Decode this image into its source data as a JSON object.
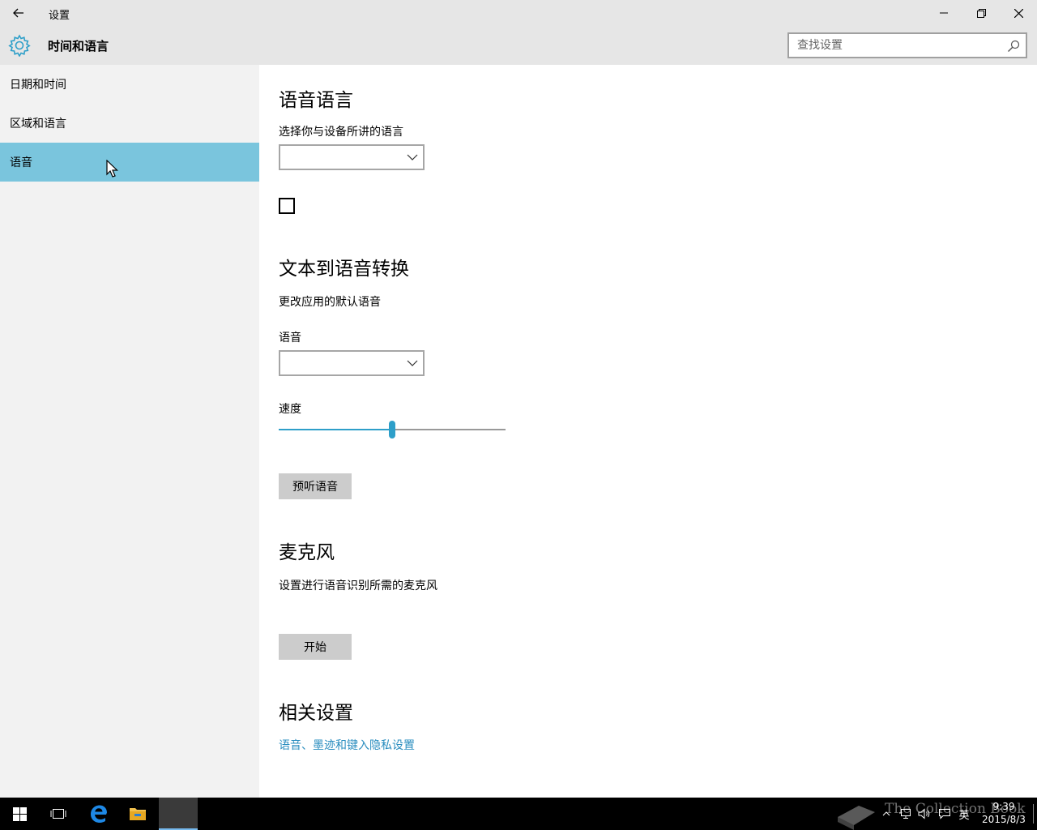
{
  "window": {
    "app_title": "设置"
  },
  "header": {
    "section_title": "时间和语言",
    "search_placeholder": "查找设置"
  },
  "sidebar": {
    "items": [
      {
        "label": "日期和时间",
        "selected": false
      },
      {
        "label": "区域和语言",
        "selected": false
      },
      {
        "label": "语音",
        "selected": true
      }
    ]
  },
  "main": {
    "speech_language": {
      "heading": "语音语言",
      "description": "选择你与设备所讲的语言",
      "dropdown_value": "",
      "checkbox_checked": false
    },
    "tts": {
      "heading": "文本到语音转换",
      "description": "更改应用的默认语音",
      "voice_label": "语音",
      "voice_value": "",
      "speed_label": "速度",
      "speed_level": 0.5,
      "preview_button": "预听语音"
    },
    "microphone": {
      "heading": "麦克风",
      "description": "设置进行语音识别所需的麦克风",
      "start_button": "开始"
    },
    "related": {
      "heading": "相关设置",
      "privacy_link": "语音、墨迹和键入隐私设置"
    }
  },
  "taskbar": {
    "time": "9:39",
    "date": "2015/8/3",
    "input_method": "英",
    "watermark": "The Collection Book"
  },
  "colors": {
    "accent": "#2e9fc9",
    "selected_nav": "#7ac5dd",
    "chrome": "#e6e6e6",
    "sidebar_bg": "#f2f2f2",
    "link": "#2a8dbf"
  }
}
